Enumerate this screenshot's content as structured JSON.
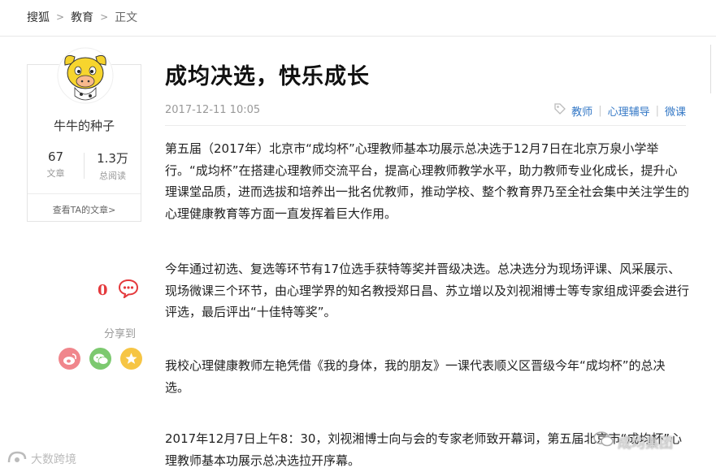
{
  "breadcrumb": {
    "site": "搜狐",
    "section": "教育",
    "current": "正文"
  },
  "author": {
    "name": "牛牛的种子",
    "articles_count": "67",
    "articles_label": "文章",
    "reads_count": "1.3万",
    "reads_label": "总阅读",
    "view_all": "查看TA的文章>"
  },
  "interaction": {
    "comment_count": "0",
    "share_label": "分享到"
  },
  "share_icons": [
    "weibo-icon",
    "wechat-icon",
    "favorite-star-icon"
  ],
  "colors": {
    "weibo": "#f0868c",
    "wechat": "#7cc96f",
    "star": "#f6c544",
    "tag": "#3478c6",
    "comment": "#e4393c"
  },
  "article": {
    "title": "成均决选，快乐成长",
    "date": "2017-12-11 10:05",
    "tags": [
      "教师",
      "心理辅导",
      "微课"
    ],
    "paragraphs": [
      "第五届（2017年）北京市“成均杯”心理教师基本功展示总决选于12月7日在北京万泉小学举行。“成均杯”在搭建心理教师交流平台，提高心理教师教学水平，助力教师专业化成长，提升心理课堂品质，进而选拔和培养出一批名优教师，推动学校、整个教育界乃至全社会集中关注学生的心理健康教育等方面一直发挥着巨大作用。",
      "今年通过初选、复选等环节有17位选手获特等奖并晋级决选。总决选分为现场评课、风采展示、现场微课三个环节，由心理学界的知名教授郑日昌、苏立增以及刘视湘博士等专家组成评委会进行评选，最后评出“十佳特等奖”。",
      "我校心理健康教师左艳凭借《我的身体，我的朋友》一课代表顺义区晋级今年“成均杯”的总决选。",
      "2017年12月7日上午8：30，刘视湘博士向与会的专家老师致开幕词，第五届北京市“成均杯”心理教师基本功展示总决选拉开序幕。"
    ]
  },
  "watermarks": {
    "left": "大数跨境",
    "right": "成均集团"
  }
}
